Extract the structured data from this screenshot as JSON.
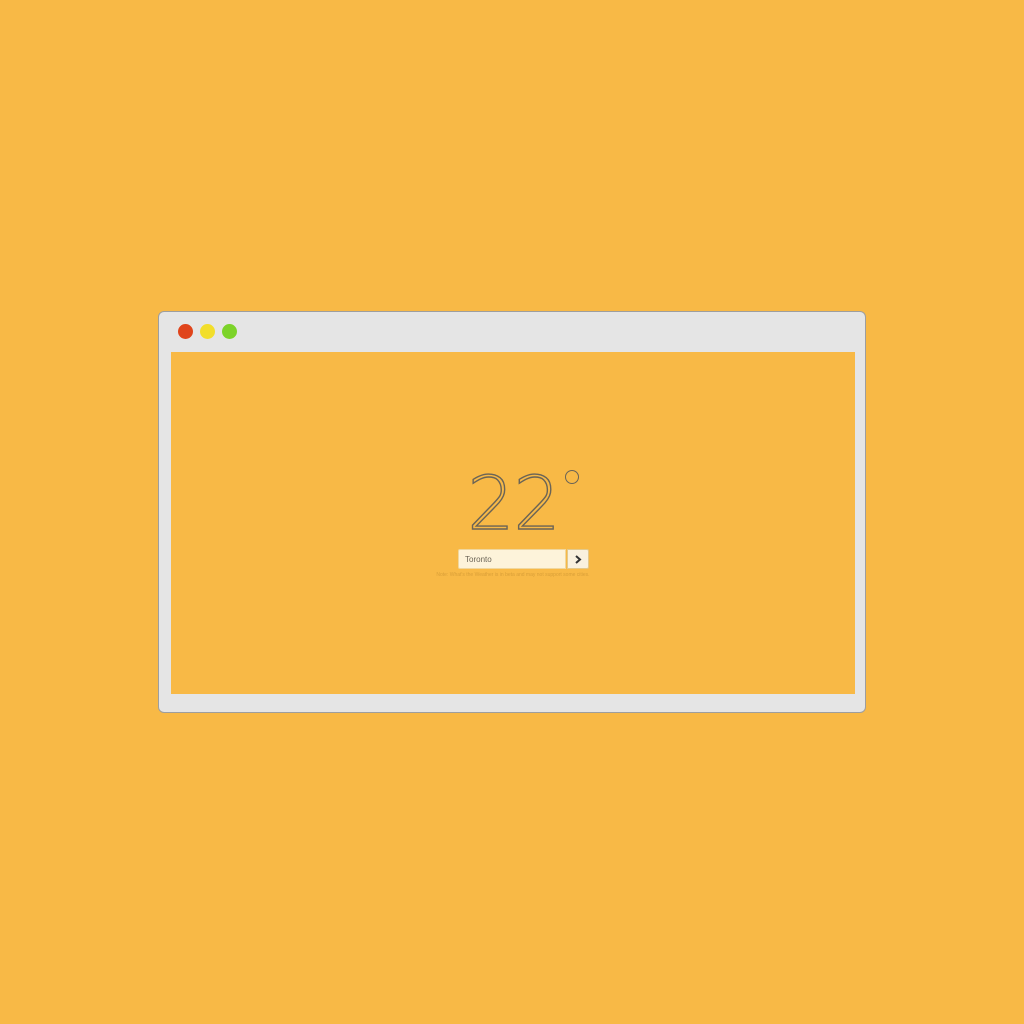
{
  "window": {
    "controls": [
      {
        "name": "close",
        "color": "#E0441B"
      },
      {
        "name": "minimize",
        "color": "#F2DE2B"
      },
      {
        "name": "zoom",
        "color": "#7CD329"
      }
    ]
  },
  "weather": {
    "temperature": "22",
    "unit_icon": "degree-symbol"
  },
  "search": {
    "value": "Toronto",
    "submit_icon": "chevron-right-icon"
  },
  "note": "Note: What's the Weather is in beta and may not support some cities.",
  "colors": {
    "background": "#F8B946",
    "window_chrome": "#E5E5E5",
    "text": "#6B6456"
  }
}
